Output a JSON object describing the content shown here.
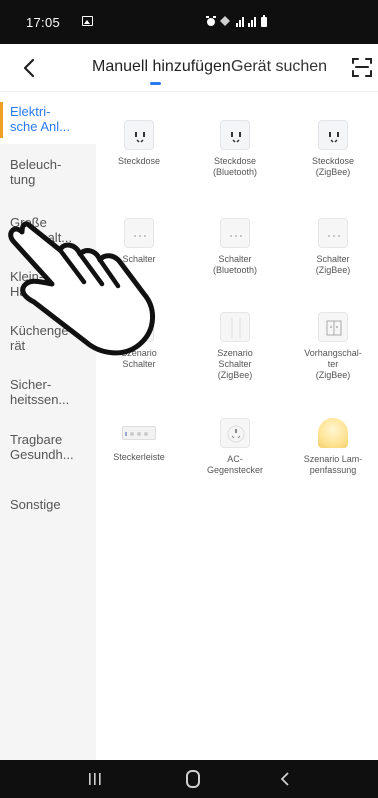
{
  "status": {
    "time": "17:05"
  },
  "header": {
    "tab_manual": "Manuell hinzufügen",
    "tab_search": "Gerät suchen",
    "accent": "#2b7bf0"
  },
  "sidebar": {
    "items": [
      {
        "label": "Elektri-\nsche Anl..."
      },
      {
        "label": "Beleuch-\ntung"
      },
      {
        "label": "Große\nHaushalt..."
      },
      {
        "label": "Klein-\nHaushalt"
      },
      {
        "label": "Küchenge-\nrät"
      },
      {
        "label": "Sicher-\nheitssen..."
      },
      {
        "label": "Tragbare\nGesundh..."
      },
      {
        "label": "Sonstige"
      }
    ],
    "active_color": "#2b7bf0",
    "indicator_color": "#f0a028"
  },
  "devices": [
    {
      "label": "Steckdose",
      "icon": "socket-icon"
    },
    {
      "label": "Steckdose\n(Bluetooth)",
      "icon": "socket-icon"
    },
    {
      "label": "Steckdose\n(ZigBee)",
      "icon": "socket-icon"
    },
    {
      "label": "Schalter",
      "icon": "switch-icon"
    },
    {
      "label": "Schalter\n(Bluetooth)",
      "icon": "switch-icon"
    },
    {
      "label": "Schalter\n(ZigBee)",
      "icon": "switch-icon"
    },
    {
      "label": "Szenario\nSchalter",
      "icon": "scene-switch-icon"
    },
    {
      "label": "Szenario\nSchalter\n(ZigBee)",
      "icon": "scene-switch-icon"
    },
    {
      "label": "Vorhangschal-\nter\n(ZigBee)",
      "icon": "curtain-switch-icon"
    },
    {
      "label": "Steckerleiste",
      "icon": "power-strip-icon"
    },
    {
      "label": "AC-\nGegenstecker",
      "icon": "plug-icon"
    },
    {
      "label": "Szenario Lam-\npenfassung",
      "icon": "lamp-icon"
    }
  ]
}
